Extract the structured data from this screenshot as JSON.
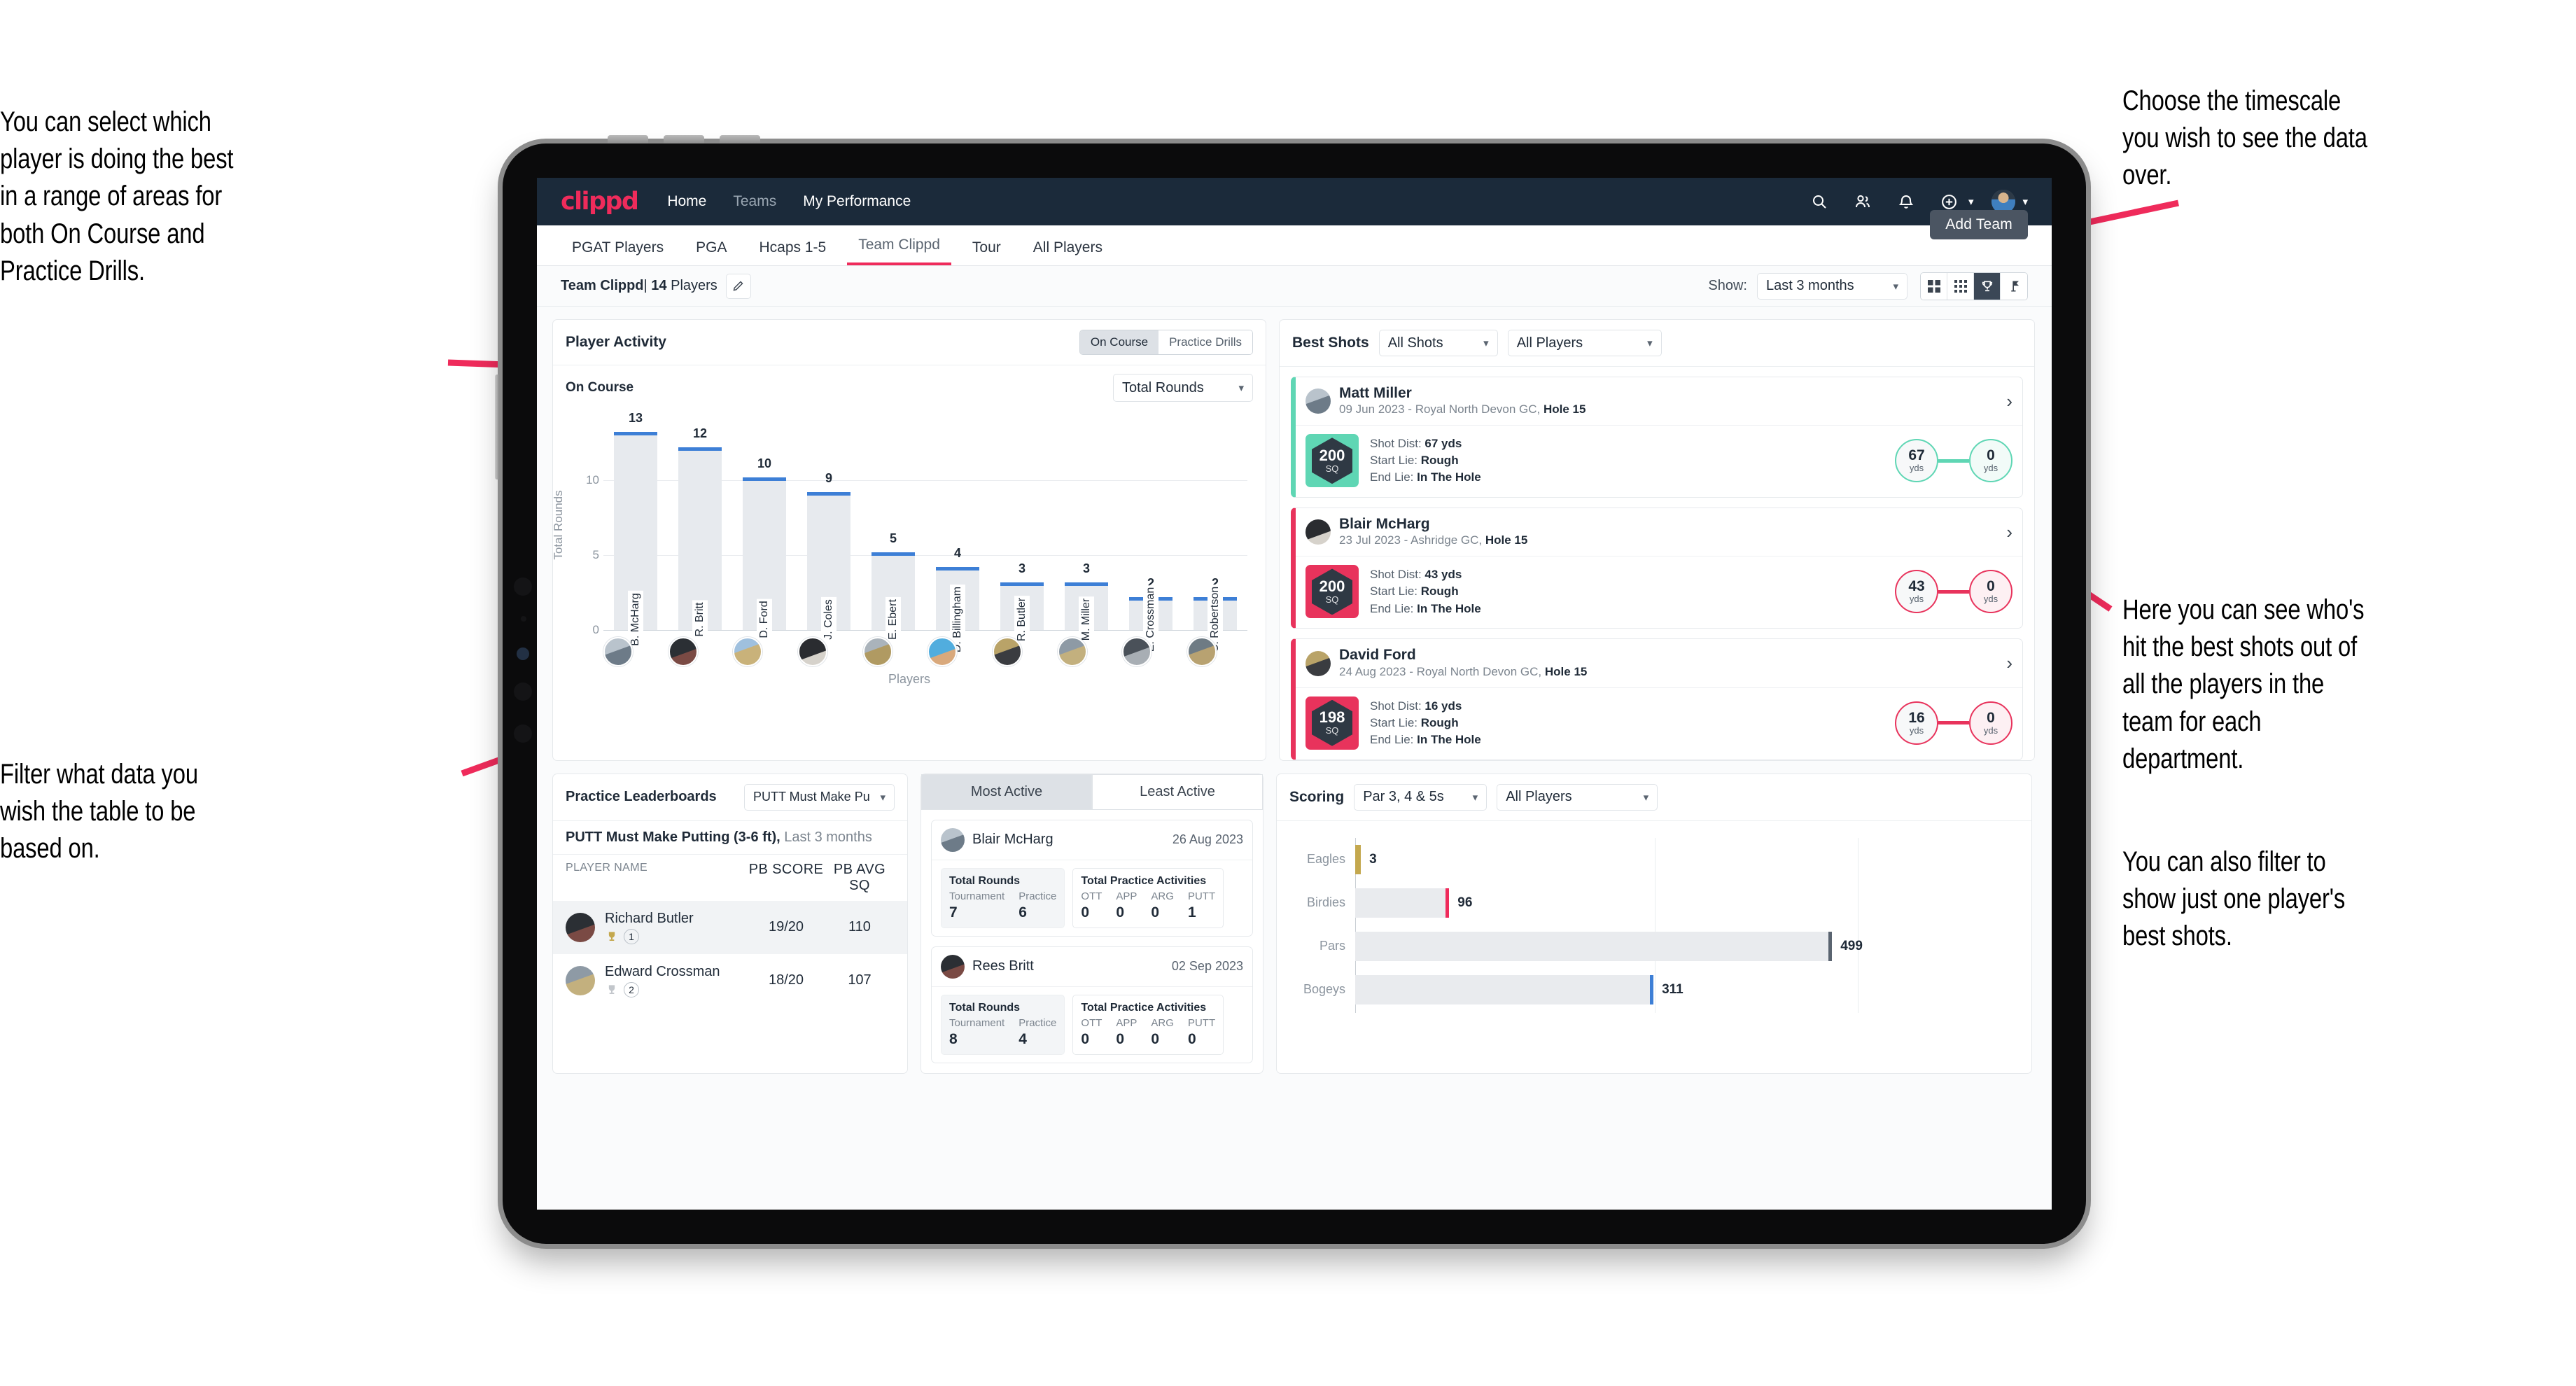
{
  "annotations": {
    "left_top": "You can select which player is doing the best in a range of areas for both On Course and Practice Drills.",
    "left_bottom": "Filter what data you wish the table to be based on.",
    "right_top": "Choose the timescale you wish to see the data over.",
    "right_mid": "Here you can see who's hit the best shots out of all the players in the team for each department.",
    "right_bottom": "You can also filter to show just one player's best shots."
  },
  "navbar": {
    "logo": "clippd",
    "links": [
      {
        "label": "Home",
        "dim": false
      },
      {
        "label": "Teams",
        "dim": true
      },
      {
        "label": "My Performance",
        "dim": false
      }
    ],
    "icons": [
      "search-icon",
      "people-icon",
      "bell-icon",
      "plus-circle-icon",
      "avatar"
    ]
  },
  "tabs": [
    {
      "label": "PGAT Players",
      "active": false
    },
    {
      "label": "PGA",
      "active": false
    },
    {
      "label": "Hcaps 1-5",
      "active": false
    },
    {
      "label": "Team Clippd",
      "active": true
    },
    {
      "label": "Tour",
      "active": false
    },
    {
      "label": "All Players",
      "active": false
    }
  ],
  "add_team_button": "Add Team",
  "subbar": {
    "team_name": "Team Clippd",
    "separator": "|",
    "player_count": "14",
    "players_word": "Players",
    "show_label": "Show:",
    "timescale": "Last 3 months",
    "view_icons": [
      "grid-large-icon",
      "grid-small-icon",
      "trophy-icon",
      "flag-icon"
    ],
    "active_view": 2
  },
  "player_activity": {
    "title": "Player Activity",
    "segments": [
      {
        "label": "On Course",
        "active": true
      },
      {
        "label": "Practice Drills",
        "active": false
      }
    ],
    "sub_label": "On Course",
    "metric_select": "Total Rounds"
  },
  "chart_data": {
    "type": "bar",
    "title": "Player Activity",
    "xlabel": "Players",
    "ylabel": "Total Rounds",
    "ylim": [
      0,
      14
    ],
    "yticks": [
      0,
      5,
      10
    ],
    "grid": true,
    "categories": [
      "B. McHarg",
      "R. Britt",
      "D. Ford",
      "J. Coles",
      "E. Ebert",
      "D. Billingham",
      "R. Butler",
      "M. Miller",
      "E. Crossman",
      "C. Robertson"
    ],
    "values": [
      13,
      12,
      10,
      9,
      5,
      4,
      3,
      3,
      2,
      2
    ],
    "bar_color": "#e7eaee",
    "cap_color": "#3d7fd6"
  },
  "best_shots": {
    "title": "Best Shots",
    "filter_shots": "All Shots",
    "filter_players": "All Players",
    "rows": [
      {
        "name": "Matt Miller",
        "date": "09 Jun 2023",
        "course": "Royal North Devon GC,",
        "hole": "Hole 15",
        "badge_value": "200",
        "badge_unit": "SQ",
        "badge_color": "#5fd6b4",
        "accent": "#5fd6b4",
        "shot_dist_label": "Shot Dist:",
        "shot_dist": "67 yds",
        "start_lie_label": "Start Lie:",
        "start_lie": "Rough",
        "end_lie_label": "End Lie:",
        "end_lie": "In The Hole",
        "from_value": "67",
        "from_unit": "yds",
        "to_value": "0",
        "to_unit": "yds"
      },
      {
        "name": "Blair McHarg",
        "date": "23 Jul 2023",
        "course": "Ashridge GC,",
        "hole": "Hole 15",
        "badge_value": "200",
        "badge_unit": "SQ",
        "badge_color": "#e8335c",
        "accent": "#e8335c",
        "shot_dist_label": "Shot Dist:",
        "shot_dist": "43 yds",
        "start_lie_label": "Start Lie:",
        "start_lie": "Rough",
        "end_lie_label": "End Lie:",
        "end_lie": "In The Hole",
        "from_value": "43",
        "from_unit": "yds",
        "to_value": "0",
        "to_unit": "yds"
      },
      {
        "name": "David Ford",
        "date": "24 Aug 2023",
        "course": "Royal North Devon GC,",
        "hole": "Hole 15",
        "badge_value": "198",
        "badge_unit": "SQ",
        "badge_color": "#e8335c",
        "accent": "#e8335c",
        "shot_dist_label": "Shot Dist:",
        "shot_dist": "16 yds",
        "start_lie_label": "Start Lie:",
        "start_lie": "Rough",
        "end_lie_label": "End Lie:",
        "end_lie": "In The Hole",
        "from_value": "16",
        "from_unit": "yds",
        "to_value": "0",
        "to_unit": "yds"
      }
    ]
  },
  "practice_leaderboards": {
    "title": "Practice Leaderboards",
    "drill_select": "PUTT Must Make Putting ...",
    "subtitle_bold": "PUTT Must Make Putting (3-6 ft),",
    "subtitle_light": "Last 3 months",
    "columns": [
      "PLAYER NAME",
      "PB SCORE",
      "PB AVG SQ"
    ],
    "rows": [
      {
        "name": "Richard Butler",
        "rank": "1",
        "trophy_color": "#c4a84e",
        "pb_score": "19/20",
        "pb_avg_sq": "110"
      },
      {
        "name": "Edward Crossman",
        "rank": "2",
        "trophy_color": "#c2c6cb",
        "pb_score": "18/20",
        "pb_avg_sq": "107"
      }
    ]
  },
  "activity": {
    "tabs": [
      {
        "label": "Most Active",
        "active": true
      },
      {
        "label": "Least Active",
        "active": false
      }
    ],
    "items": [
      {
        "name": "Blair McHarg",
        "date": "26 Aug 2023",
        "rounds_title": "Total Rounds",
        "rounds": [
          {
            "key": "Tournament",
            "value": "7"
          },
          {
            "key": "Practice",
            "value": "6"
          }
        ],
        "practice_title": "Total Practice Activities",
        "practice": [
          {
            "key": "OTT",
            "value": "0"
          },
          {
            "key": "APP",
            "value": "0"
          },
          {
            "key": "ARG",
            "value": "0"
          },
          {
            "key": "PUTT",
            "value": "1"
          }
        ]
      },
      {
        "name": "Rees Britt",
        "date": "02 Sep 2023",
        "rounds_title": "Total Rounds",
        "rounds": [
          {
            "key": "Tournament",
            "value": "8"
          },
          {
            "key": "Practice",
            "value": "4"
          }
        ],
        "practice_title": "Total Practice Activities",
        "practice": [
          {
            "key": "OTT",
            "value": "0"
          },
          {
            "key": "APP",
            "value": "0"
          },
          {
            "key": "ARG",
            "value": "0"
          },
          {
            "key": "PUTT",
            "value": "0"
          }
        ]
      }
    ]
  },
  "scoring": {
    "title": "Scoring",
    "filter_par": "Par 3, 4 & 5s",
    "filter_players": "All Players",
    "chart": {
      "type": "bar",
      "orientation": "horizontal",
      "categories": [
        "Eagles",
        "Birdies",
        "Pars",
        "Bogeys"
      ],
      "values": [
        3,
        96,
        499,
        311
      ],
      "xmax": 560,
      "colors": [
        "#c4a84e",
        "#ef2b5b",
        "#5a6470",
        "#3d7fd6"
      ]
    }
  }
}
